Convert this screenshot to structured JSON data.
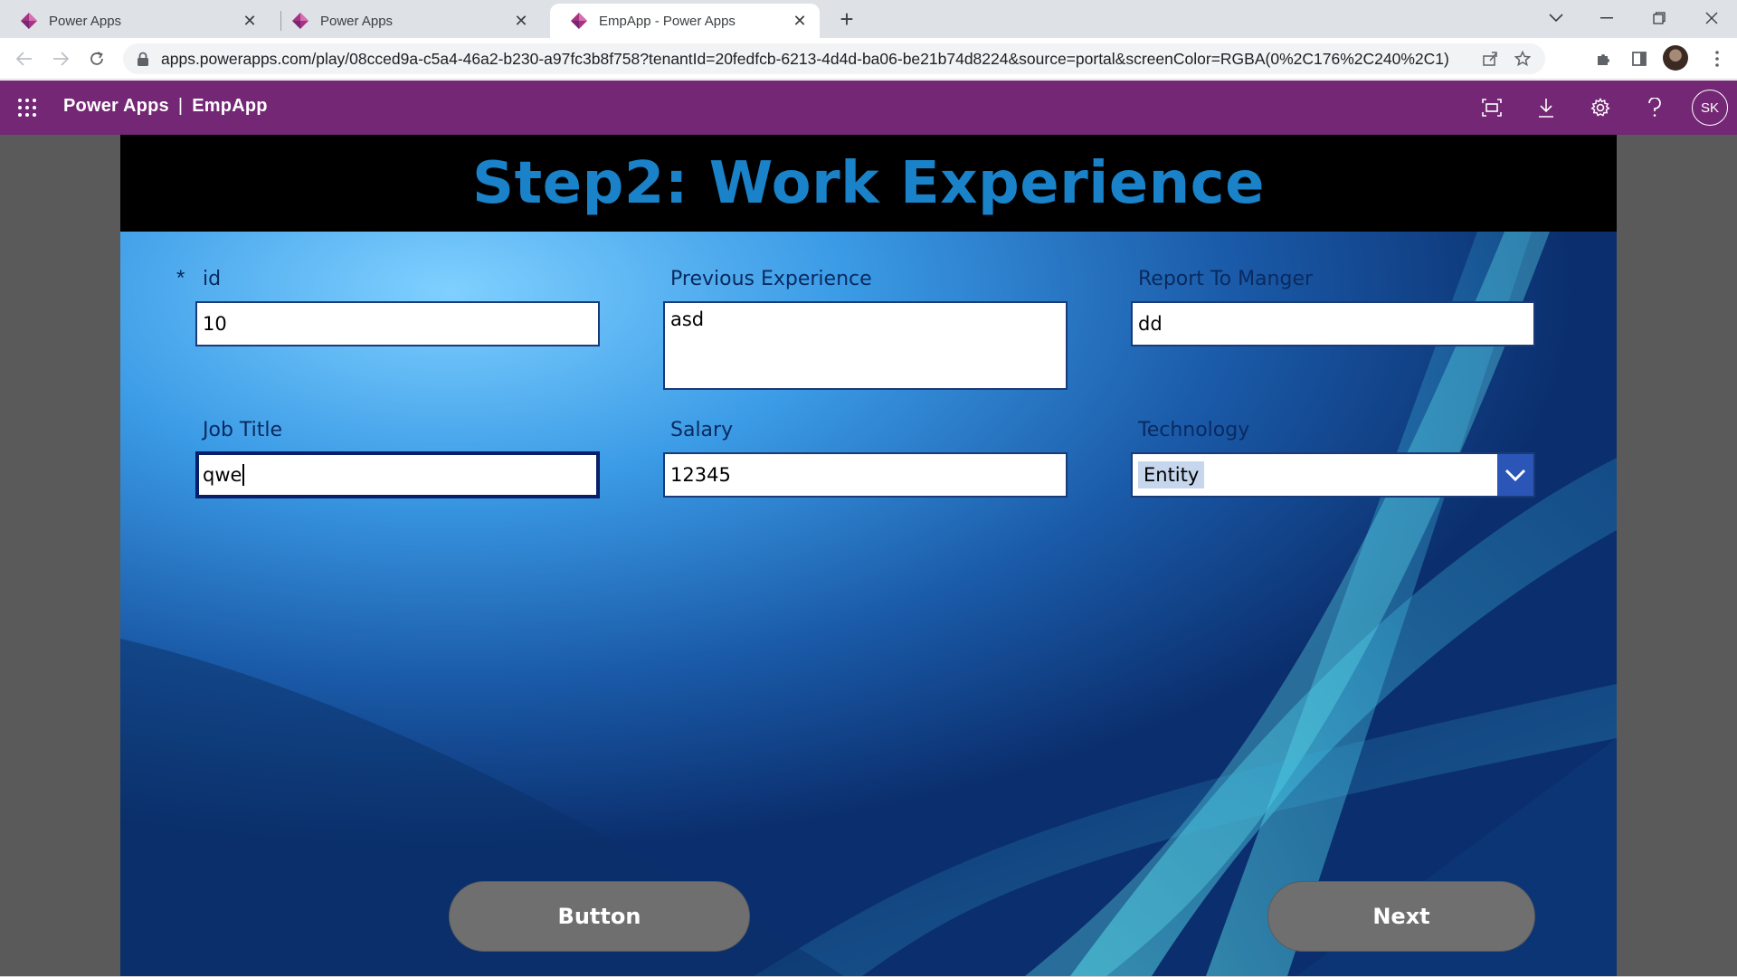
{
  "browser": {
    "tabs": [
      {
        "title": "Power Apps",
        "active": false
      },
      {
        "title": "Power Apps",
        "active": false
      },
      {
        "title": "EmpApp - Power Apps",
        "active": true
      }
    ],
    "url": "apps.powerapps.com/play/08cced9a-c5a4-46a2-b230-a97fc3b8f758?tenantId=20fedfcb-6213-4d4d-ba06-be21b74d8224&source=portal&screenColor=RGBA(0%2C176%2C240%2C1)"
  },
  "header": {
    "product": "Power Apps",
    "separator": "|",
    "app_name": "EmpApp",
    "avatar_initials": "SK"
  },
  "screen": {
    "title": "Step2: Work Experience",
    "fields": {
      "id": {
        "label": "id",
        "required_mark": "*",
        "value": "10"
      },
      "previous_experience": {
        "label": "Previous Experience",
        "value": "asd"
      },
      "report_to_manager": {
        "label": "Report To Manger",
        "value": "dd"
      },
      "job_title": {
        "label": "Job Title",
        "value": "qwe"
      },
      "salary": {
        "label": "Salary",
        "value": "12345"
      },
      "technology": {
        "label": "Technology",
        "selected": "Entity"
      }
    },
    "buttons": {
      "button_label": "Button",
      "next_label": "Next"
    }
  },
  "colors": {
    "header_purple": "#742774",
    "title_blue": "#1a82c8",
    "label_navy": "#0a2a60",
    "button_gray": "#6f6f6f",
    "dropdown_chevron": "#2c55b8"
  }
}
